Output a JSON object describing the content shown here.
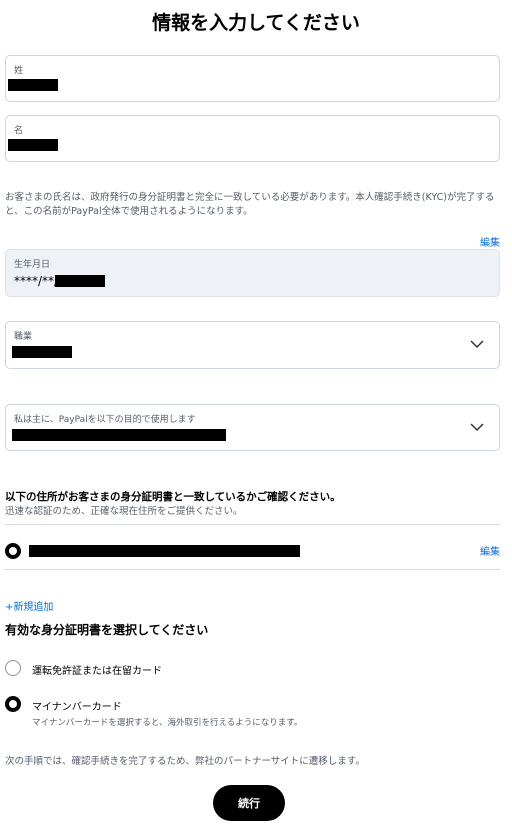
{
  "header": {
    "title": "情報を入力してください"
  },
  "name_fields": {
    "last_name_label": "姓",
    "first_name_label": "名"
  },
  "name_note": "お客さまの氏名は、政府発行の身分証明書と完全に一致している必要があります。本人確認手続き(KYC)が完了すると、この名前がPayPal全体で使用されるようになります。",
  "edit_link": "編集",
  "birthdate": {
    "label": "生年月日",
    "value_prefix": "****/**/"
  },
  "occupation": {
    "label": "職業"
  },
  "purpose": {
    "label": "私は主に、PayPalを以下の目的で使用します"
  },
  "address_section": {
    "heading": "以下の住所がお客さまの身分証明書と一致しているかご確認ください。",
    "subheading": "迅速な認証のため、正確な現在住所をご提供ください。",
    "edit_link": "編集",
    "add_new": "+新規追加"
  },
  "id_section": {
    "title": "有効な身分証明書を選択してください",
    "options": [
      {
        "label": "運転免許証または在留カード",
        "description": "",
        "selected": false
      },
      {
        "label": "マイナンバーカード",
        "description": "マイナンバーカードを選択すると、海外取引を行えるようになります。",
        "selected": true
      }
    ]
  },
  "footer_note": "次の手順では、確認手続きを完了するため、弊社のパートナーサイトに遷移します。",
  "continue_button": "続行",
  "colors": {
    "link": "#0070e0",
    "button": "#000000",
    "text": "#000000",
    "muted": "#545d68"
  }
}
